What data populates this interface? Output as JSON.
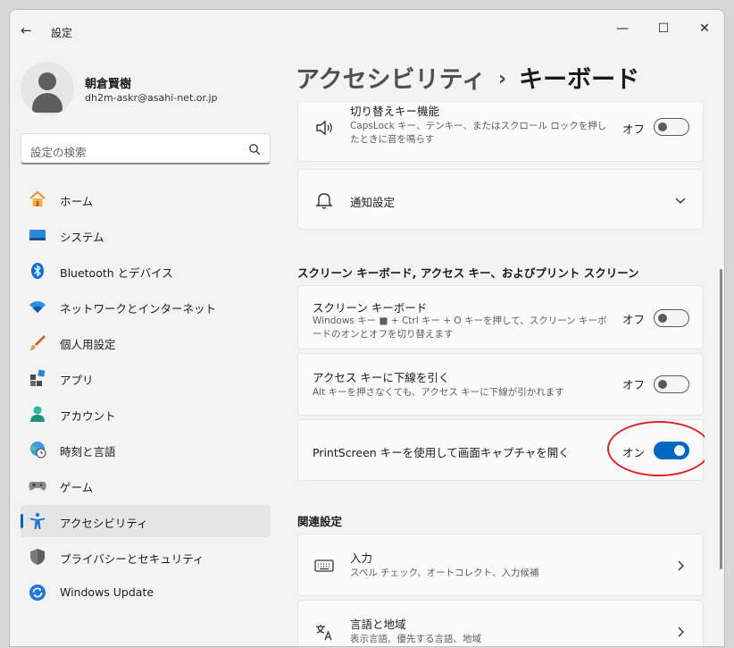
{
  "window": {
    "title": "設定",
    "back": "←",
    "minimize": "—",
    "maximize": "☐",
    "close": "✕"
  },
  "profile": {
    "name": "朝倉賢樹",
    "email": "dh2m-askr@asahi-net.or.jp"
  },
  "search": {
    "placeholder": "設定の検索"
  },
  "nav": {
    "items": [
      {
        "label": "ホーム",
        "icon": "home-icon"
      },
      {
        "label": "システム",
        "icon": "system-icon"
      },
      {
        "label": "Bluetooth とデバイス",
        "icon": "bluetooth-icon"
      },
      {
        "label": "ネットワークとインターネット",
        "icon": "wifi-icon"
      },
      {
        "label": "個人用設定",
        "icon": "brush-icon"
      },
      {
        "label": "アプリ",
        "icon": "apps-icon"
      },
      {
        "label": "アカウント",
        "icon": "account-icon"
      },
      {
        "label": "時刻と言語",
        "icon": "globe-clock-icon"
      },
      {
        "label": "ゲーム",
        "icon": "gamepad-icon"
      },
      {
        "label": "アクセシビリティ",
        "icon": "accessibility-icon",
        "active": true
      },
      {
        "label": "プライバシーとセキュリティ",
        "icon": "shield-icon"
      },
      {
        "label": "Windows Update",
        "icon": "update-icon"
      }
    ]
  },
  "breadcrumb": {
    "parent": "アクセシビリティ",
    "separator": "›",
    "current": "キーボード"
  },
  "main": {
    "toggle_keys": {
      "title": "切り替えキー機能",
      "desc": "CapsLock キー、テンキー、またはスクロール ロックを押したときに音を鳴らす",
      "state": "オフ",
      "on": false
    },
    "notifications": {
      "title": "通知設定"
    },
    "section_screen": "スクリーン キーボード, アクセス キー、およびプリント スクリーン",
    "screen_keyboard": {
      "title": "スクリーン キーボード",
      "desc": "Windows キー ■ + Ctrl キー + O キーを押して、スクリーン キーボードのオンとオフを切り替えます",
      "state": "オフ",
      "on": false
    },
    "access_keys": {
      "title": "アクセス キーに下線を引く",
      "desc": "Alt キーを押さなくても、アクセス キーに下線が引かれます",
      "state": "オフ",
      "on": false
    },
    "printscreen": {
      "title": "PrintScreen キーを使用して画面キャプチャを開く",
      "state": "オン",
      "on": true
    },
    "section_related": "関連設定",
    "input": {
      "title": "入力",
      "desc": "スペル チェック、オートコレクト、入力候補"
    },
    "language": {
      "title": "言語と地域",
      "desc": "表示言語、優先する言語、地域"
    }
  },
  "colors": {
    "accent": "#0067c0",
    "highlight_ring": "#d9242b"
  }
}
